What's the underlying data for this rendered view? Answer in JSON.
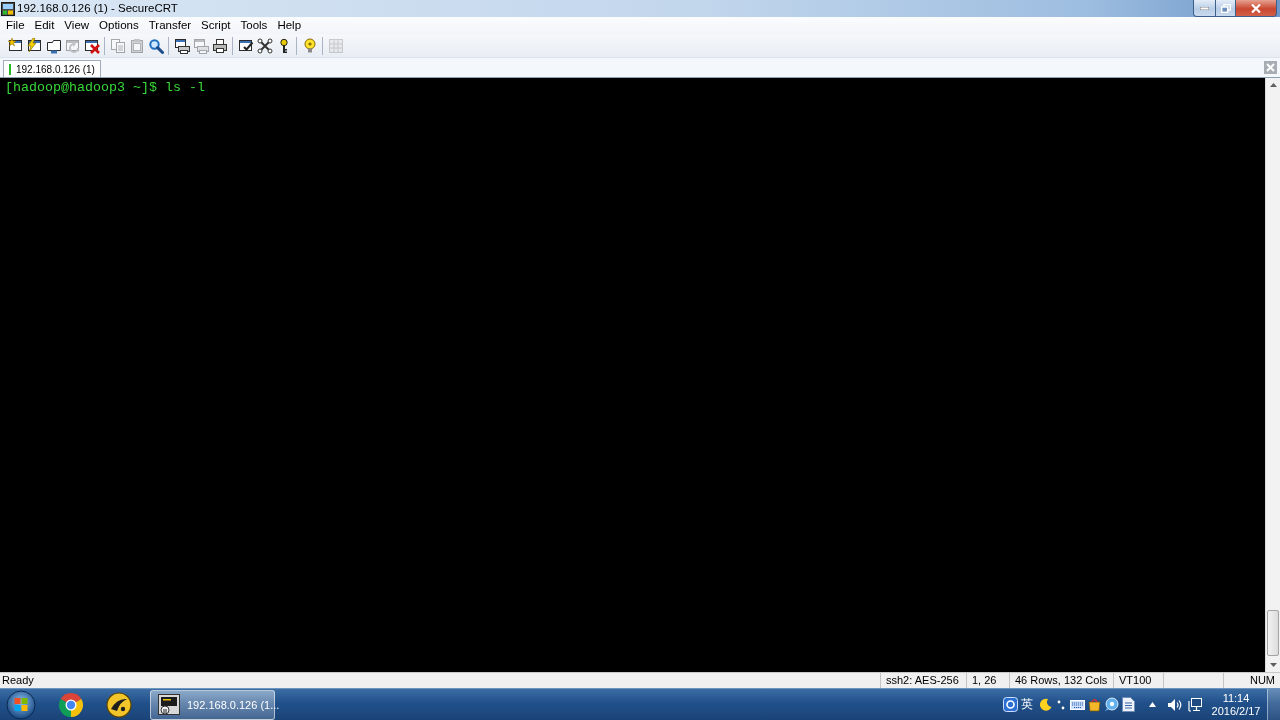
{
  "window": {
    "title": "192.168.0.126 (1) - SecureCRT"
  },
  "menu": [
    "File",
    "Edit",
    "View",
    "Options",
    "Transfer",
    "Script",
    "Tools",
    "Help"
  ],
  "toolbar": {
    "groups": [
      {
        "items": [
          {
            "disabled": false
          },
          {
            "disabled": false
          },
          {
            "disabled": false
          },
          {
            "disabled": true
          },
          {
            "disabled": false
          }
        ]
      },
      {
        "items": [
          {
            "disabled": true
          },
          {
            "disabled": true
          },
          {
            "disabled": false
          }
        ]
      },
      {
        "items": [
          {
            "disabled": false
          },
          {
            "disabled": true
          },
          {
            "disabled": false
          }
        ]
      },
      {
        "items": [
          {
            "disabled": false
          },
          {
            "disabled": false
          },
          {
            "disabled": false
          }
        ]
      },
      {
        "items": [
          {
            "disabled": false
          }
        ]
      },
      {
        "items": [
          {
            "disabled": true
          }
        ]
      }
    ]
  },
  "tabs": [
    {
      "label": "192.168.0.126 (1)",
      "selected": true,
      "connected": true
    }
  ],
  "terminal": {
    "lines": [
      "[hadoop@hadoop3 ~]$ ls -l"
    ]
  },
  "status_bar": {
    "message": "Ready",
    "panes": [
      "ssh2: AES-256",
      "1, 26",
      "46 Rows, 132 Cols",
      "VT100"
    ],
    "indicator": "NUM"
  },
  "taskbar": {
    "tasks": [
      {
        "label": "192.168.0.126 (1...",
        "selected": true
      }
    ],
    "tray": {
      "ime_mode": "英",
      "time": "11:14",
      "date": "2016/2/17"
    }
  }
}
